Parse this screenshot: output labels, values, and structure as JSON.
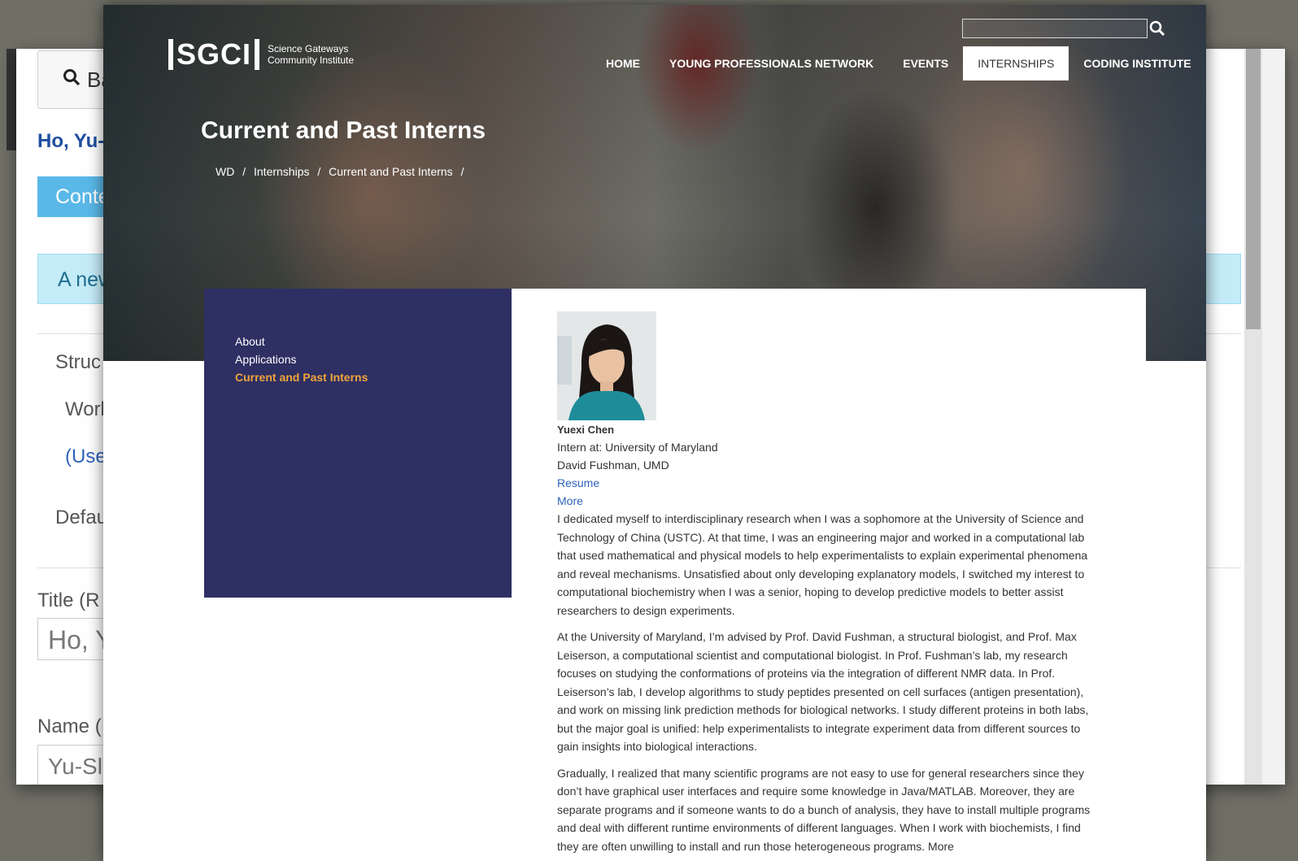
{
  "background_window": {
    "search_label": "Ba",
    "heading": "Ho, Yu-",
    "tab_label": "Conte",
    "alert_text": "A new",
    "field_structure": "Struc",
    "field_work": "Worl",
    "field_user": "(Use",
    "field_default": "Defau",
    "label_title": "Title (R",
    "title_value": "Ho, Y",
    "label_name": "Name (",
    "name_value": "Yu-Sl"
  },
  "header": {
    "logo_text": "SGCI",
    "logo_subtitle_1": "Science Gateways",
    "logo_subtitle_2": "Community Institute",
    "search_placeholder": "",
    "nav": [
      {
        "label": "HOME"
      },
      {
        "label": "YOUNG PROFESSIONALS NETWORK"
      },
      {
        "label": "EVENTS"
      },
      {
        "label": "INTERNSHIPS"
      },
      {
        "label": "CODING INSTITUTE"
      }
    ],
    "page_title": "Current and Past Interns",
    "breadcrumb": [
      "WD",
      "/",
      "Internships",
      "/",
      "Current and Past Interns",
      "/"
    ]
  },
  "sidebar": {
    "items": [
      {
        "label": "About"
      },
      {
        "label": "Applications"
      },
      {
        "label": "Current and Past Interns"
      }
    ]
  },
  "profile": {
    "name": "Yuexi Chen",
    "intern_at": "Intern at: University of Maryland",
    "mentor": "David Fushman, UMD",
    "resume_link": "Resume",
    "more_link": "More",
    "paragraphs": [
      "I dedicated myself to interdisciplinary research when I was a sophomore at the University of Science and Technology of China (USTC). At that time, I was an engineering major and worked in a computational lab that used mathematical and physical models to help experimentalists to explain experimental phenomena and reveal mechanisms. Unsatisfied about only developing explanatory models, I switched my interest to computational biochemistry when I was a senior, hoping to develop predictive models to better assist researchers to design experiments.",
      "At the University of Maryland, I’m advised by Prof. David Fushman, a structural biologist, and Prof. Max Leiserson, a computational scientist and computational biologist. In Prof. Fushman’s lab, my research focuses on studying the conformations of proteins via the integration of different NMR data. In Prof. Leiserson’s lab, I develop algorithms to study peptides presented on cell surfaces (antigen presentation), and work on missing link prediction methods for biological networks. I study different proteins in both labs, but the major goal is unified: help experimentalists to integrate experiment data from different sources to gain insights into biological interactions.",
      "Gradually, I realized that many scientific programs are not easy to use for general researchers since they don’t have graphical user interfaces and require some knowledge in Java/MATLAB. Moreover, they are separate programs and if someone wants to do a bunch of analysis, they have to install multiple programs and deal with different runtime environments of different languages. When I work with biochemists, I find they are often unwilling to install and run those heterogeneous programs. More"
    ]
  },
  "colors": {
    "sidebar_bg": "#2e2f63",
    "sidebar_active": "#f0a43a",
    "link": "#2e63b8",
    "bg_tab": "#5ab8e8",
    "bg_heading": "#1f4ea0"
  }
}
